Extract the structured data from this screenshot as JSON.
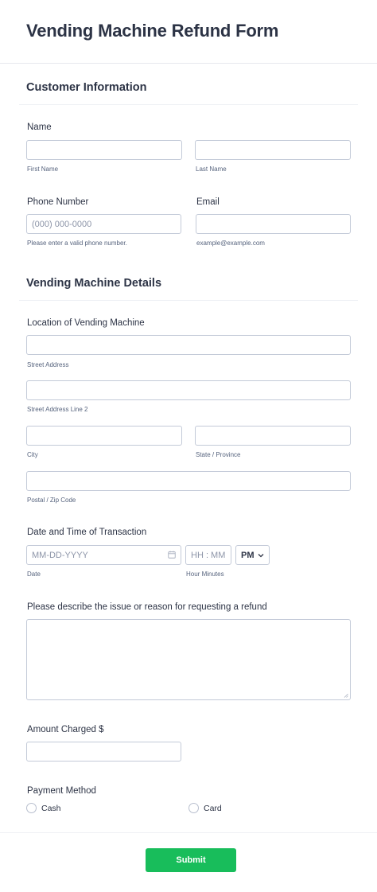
{
  "form": {
    "title": "Vending Machine Refund Form"
  },
  "customer": {
    "section_title": "Customer Information",
    "name_label": "Name",
    "first_name_sublabel": "First Name",
    "last_name_sublabel": "Last Name",
    "phone_label": "Phone Number",
    "phone_placeholder": "(000) 000-0000",
    "phone_sublabel": "Please enter a valid phone number.",
    "email_label": "Email",
    "email_sublabel": "example@example.com"
  },
  "machine": {
    "section_title": "Vending Machine Details",
    "location_label": "Location of Vending Machine",
    "street_sublabel": "Street Address",
    "street2_sublabel": "Street Address Line 2",
    "city_sublabel": "City",
    "state_sublabel": "State / Province",
    "postal_sublabel": "Postal / Zip Code",
    "datetime_label": "Date and Time of Transaction",
    "date_placeholder": "MM-DD-YYYY",
    "date_sublabel": "Date",
    "time_placeholder": "HH : MM",
    "time_sublabel": "Hour Minutes",
    "ampm_value": "PM",
    "reason_label": "Please describe the issue or reason for requesting a refund",
    "amount_label": "Amount Charged $",
    "payment_label": "Payment Method",
    "payment_options": [
      "Cash",
      "Card"
    ]
  },
  "actions": {
    "submit_label": "Submit"
  },
  "colors": {
    "accent": "#18bd5b",
    "text": "#2c3345",
    "border": "#c3cad8"
  }
}
